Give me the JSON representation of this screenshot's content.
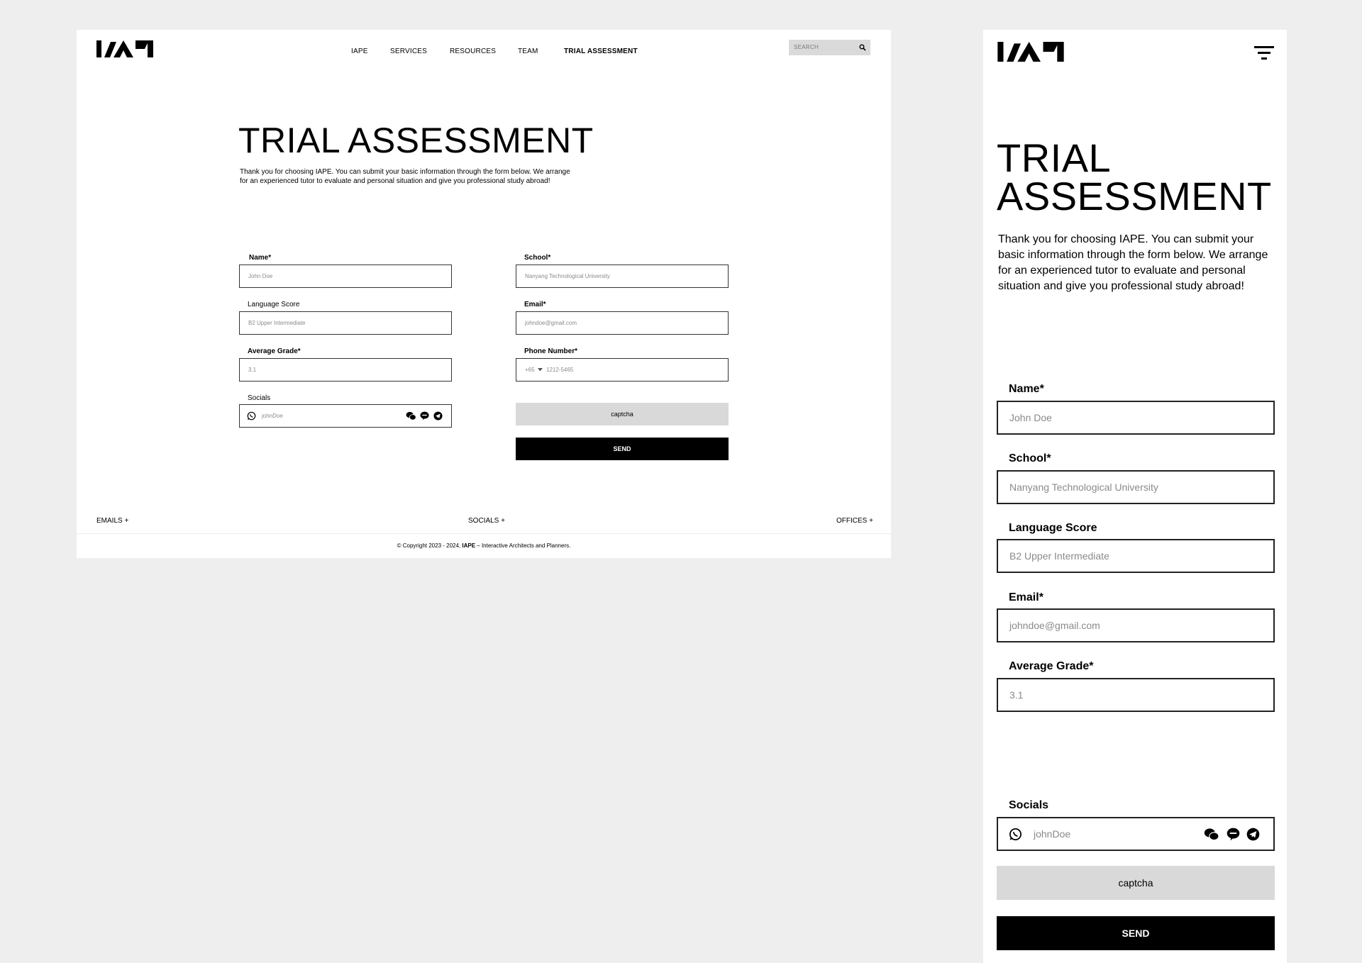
{
  "brand": {
    "logo_alt": "IAPE logo"
  },
  "desktop": {
    "nav": [
      "IAPE",
      "SERVICES",
      "RESOURCES",
      "TEAM",
      "TRIAL ASSESSMENT"
    ],
    "search_placeholder": "SEARCH",
    "title": "TRIAL ASSESSMENT",
    "intro_line1": "Thank you for choosing IAPE. You can submit your basic information through the form below. We arrange",
    "intro_line2": "for an experienced tutor to evaluate and personal situation and give you professional study abroad!",
    "form": {
      "name_label": "Name*",
      "name_ph": "John Doe",
      "school_label": "School*",
      "school_ph": "Nanyang Technological University",
      "lang_label": "Language Score",
      "lang_ph": "B2 Upper Intermediate",
      "email_label": "Email*",
      "email_ph": "johndoe@gmail.com",
      "grade_label": "Average Grade*",
      "grade_ph": "3.1",
      "phone_label": "Phone Number*",
      "phone_code": "+65",
      "phone_ph": "1212-5465",
      "socials_label": "Socials",
      "socials_ph": "johnDoe",
      "captcha": "captcha",
      "send": "SEND"
    },
    "footer": {
      "emails": "EMAILS +",
      "socials": "SOCIALS +",
      "offices": "OFFICES +",
      "copyright_pre": "© Copyright 2023 - 2024, ",
      "copyright_brand": "IAPE",
      "copyright_post": " – Interactive Architects and Planners."
    }
  },
  "mobile": {
    "title_line1": "TRIAL",
    "title_line2": "ASSESSMENT",
    "intro": "Thank you for choosing IAPE. You can submit your basic information through the form below. We arrange for an experienced tutor to evaluate and personal situation and give you professional study abroad!",
    "form": {
      "name_label": "Name*",
      "name_ph": "John Doe",
      "school_label": "School*",
      "school_ph": "Nanyang Technological University",
      "lang_label": "Language Score",
      "lang_ph": "B2 Upper Intermediate",
      "email_label": "Email*",
      "email_ph": "johndoe@gmail.com",
      "grade_label": "Average Grade*",
      "grade_ph": "3.1",
      "socials_label": "Socials",
      "socials_ph": "johnDoe",
      "captcha": "captcha",
      "send": "SEND"
    }
  },
  "icons": [
    "logo-icon",
    "search-icon",
    "whatsapp-icon",
    "wechat-icon",
    "line-icon",
    "telegram-icon",
    "filter-menu-icon",
    "chevron-down-icon"
  ],
  "colors": {
    "background": "#eeeeee",
    "frame": "#ffffff",
    "captcha_bg": "#d9d9d9",
    "send_bg": "#000000",
    "search_bg": "#dadada"
  }
}
